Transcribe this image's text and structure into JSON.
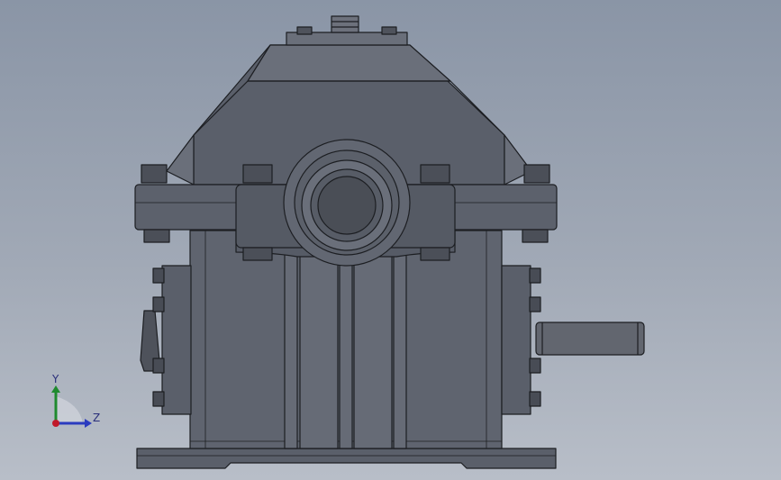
{
  "model": {
    "name": "gearbox",
    "colors": {
      "body": "#5a5f6a",
      "body_light": "#6a6f7a",
      "body_dark": "#3e4249",
      "edge": "#1c1e22",
      "shaft": "#62666f"
    }
  },
  "triad": {
    "y_label": "Y",
    "z_label": "Z",
    "y_color": "#1f8a2e",
    "z_color": "#2b3bbf",
    "origin_color": "#c0192a"
  }
}
